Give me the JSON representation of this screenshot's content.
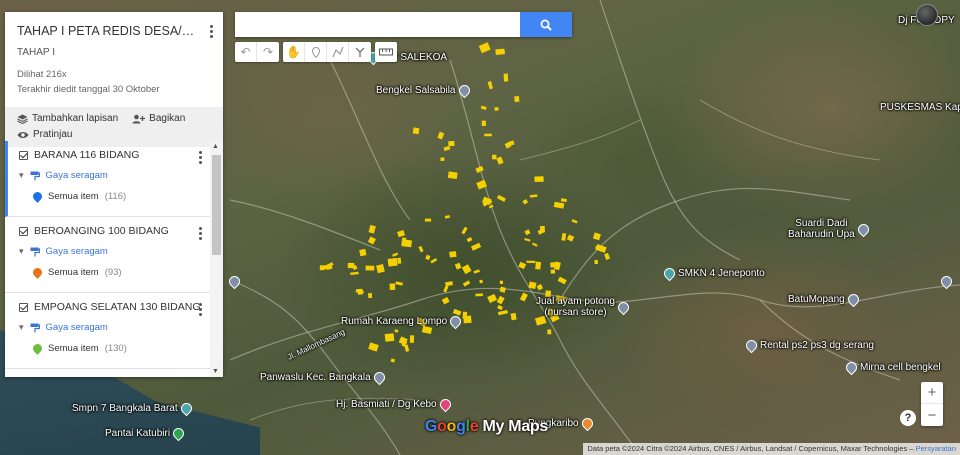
{
  "panel": {
    "title": "TAHAP I PETA REDIS DESA/KELU...",
    "subtitle": "TAHAP  I",
    "views": "Dilihat 216x",
    "edited": "Terakhir diedit tanggal 30 Oktober",
    "actions": {
      "add_layer": "Tambahkan lapisan",
      "share": "Bagikan",
      "preview": "Pratinjau"
    },
    "layers": [
      {
        "name": "BARANA 116 BIDANG",
        "style": "Gaya seragam",
        "items": "Semua item",
        "count": "(116)",
        "pin_color": "#1a73e8"
      },
      {
        "name": "BEROANGING 100 BIDANG",
        "style": "Gaya seragam",
        "items": "Semua item",
        "count": "(93)",
        "pin_color": "#e8711a"
      },
      {
        "name": "EMPOANG SELATAN 130 BIDANG",
        "style": "Gaya seragam",
        "items": "Semua item",
        "count": "(130)",
        "pin_color": "#6bbf3b"
      }
    ]
  },
  "search": {
    "value": "",
    "placeholder": ""
  },
  "places": {
    "salekoa": "N 2 SALEKOA",
    "bengkel": "Bengkel Salsabila",
    "puskesmas": "PUSKESMAS Kapi",
    "dj_fc": "Dj FC COPY",
    "suardi": "Suardi Dadi\nBaharudin Upa",
    "smkn": "SMKN 4 Jeneponto",
    "batumopang": "BatuMopang",
    "jual": "Jual ayam potong\n(nursan store)",
    "rumah": "Rumah Karaeng Lompo",
    "rental": "Rental ps2 ps3 dg serang",
    "mirna": "Mirna cell bengkel",
    "panwaslu": "Panwaslu Kec. Bangkala",
    "basmiati": "Hj. Basmiati / Dg Kebo",
    "pungkaribo": "Pungkaribo",
    "smpn": "Smpn 7 Bangkala Barat",
    "pantai": "Pantai Katubiri",
    "road": "Jl. Mallombasang"
  },
  "brand": {
    "g": "Google",
    "my_maps": " My Maps"
  },
  "attribution": {
    "text": "Data peta ©2024 Citra ©2024 Airbus, CNES / Airbus, Landsat / Copernicus, Maxar Technologies",
    "terms": "Persyaratan"
  },
  "zoom": {
    "in": "+",
    "out": "−"
  },
  "help": "?"
}
